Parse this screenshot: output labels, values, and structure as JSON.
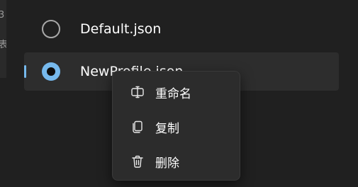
{
  "left_edge": {
    "text_a": "3",
    "text_b": "表"
  },
  "profiles": [
    {
      "name": "Default.json",
      "selected": false
    },
    {
      "name": "NewProfile.json",
      "selected": true
    }
  ],
  "context_menu": {
    "items": [
      {
        "label": "重命名",
        "icon": "rename-icon"
      },
      {
        "label": "复制",
        "icon": "copy-icon"
      },
      {
        "label": "删除",
        "icon": "delete-icon"
      }
    ]
  },
  "colors": {
    "accent": "#76b9ed",
    "background": "#202020",
    "menu_background": "#2c2c2c",
    "selected_row": "#2d2d2d"
  }
}
